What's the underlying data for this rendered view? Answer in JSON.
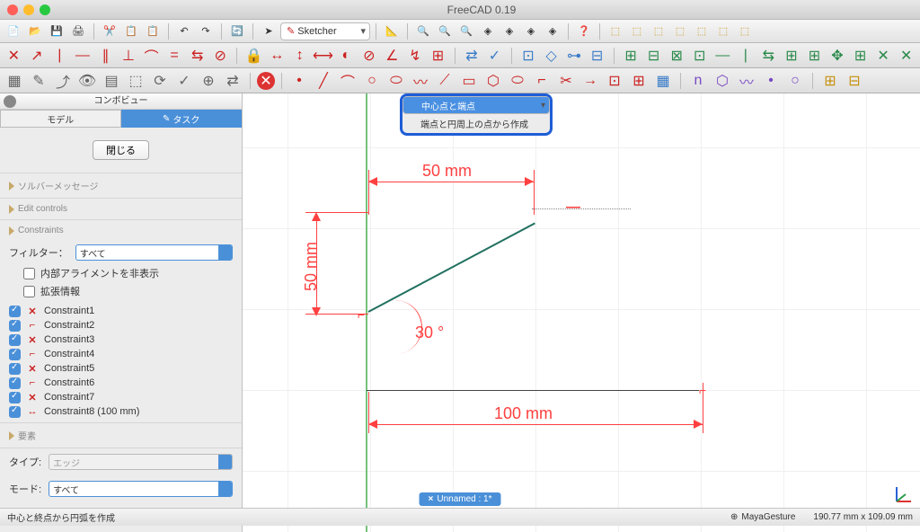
{
  "app": {
    "title": "FreeCAD 0.19"
  },
  "toolbar": {
    "workbench": "Sketcher"
  },
  "popup": {
    "item1": "中心点と端点",
    "item2": "端点と円周上の点から作成"
  },
  "combo": {
    "header": "コンボビュー",
    "tab_model": "モデル",
    "tab_task": "タスク",
    "close": "閉じる",
    "section_solver": "ソルバーメッセージ",
    "section_edit": "Edit controls",
    "section_constraints": "Constraints",
    "filter_label": "フィルター：",
    "filter_value": "すべて",
    "hide_internal": "内部アライメントを非表示",
    "extended": "拡張情報",
    "constraints": [
      "Constraint1",
      "Constraint2",
      "Constraint3",
      "Constraint4",
      "Constraint5",
      "Constraint6",
      "Constraint7",
      "Constraint8 (100 mm)"
    ],
    "section_elements": "要素",
    "type_label": "タイプ:",
    "type_value": "エッジ",
    "mode_label": "モード:",
    "mode_value": "すべて"
  },
  "dims": {
    "d50h": "50 mm",
    "d50v": "50 mm",
    "d100": "100 mm",
    "angle": "30 °"
  },
  "status": {
    "left": "中心と終点から円弧を作成",
    "tab": "Unnamed : 1*",
    "nav": "MayaGesture",
    "coords": "190.77 mm x 109.09 mm"
  }
}
